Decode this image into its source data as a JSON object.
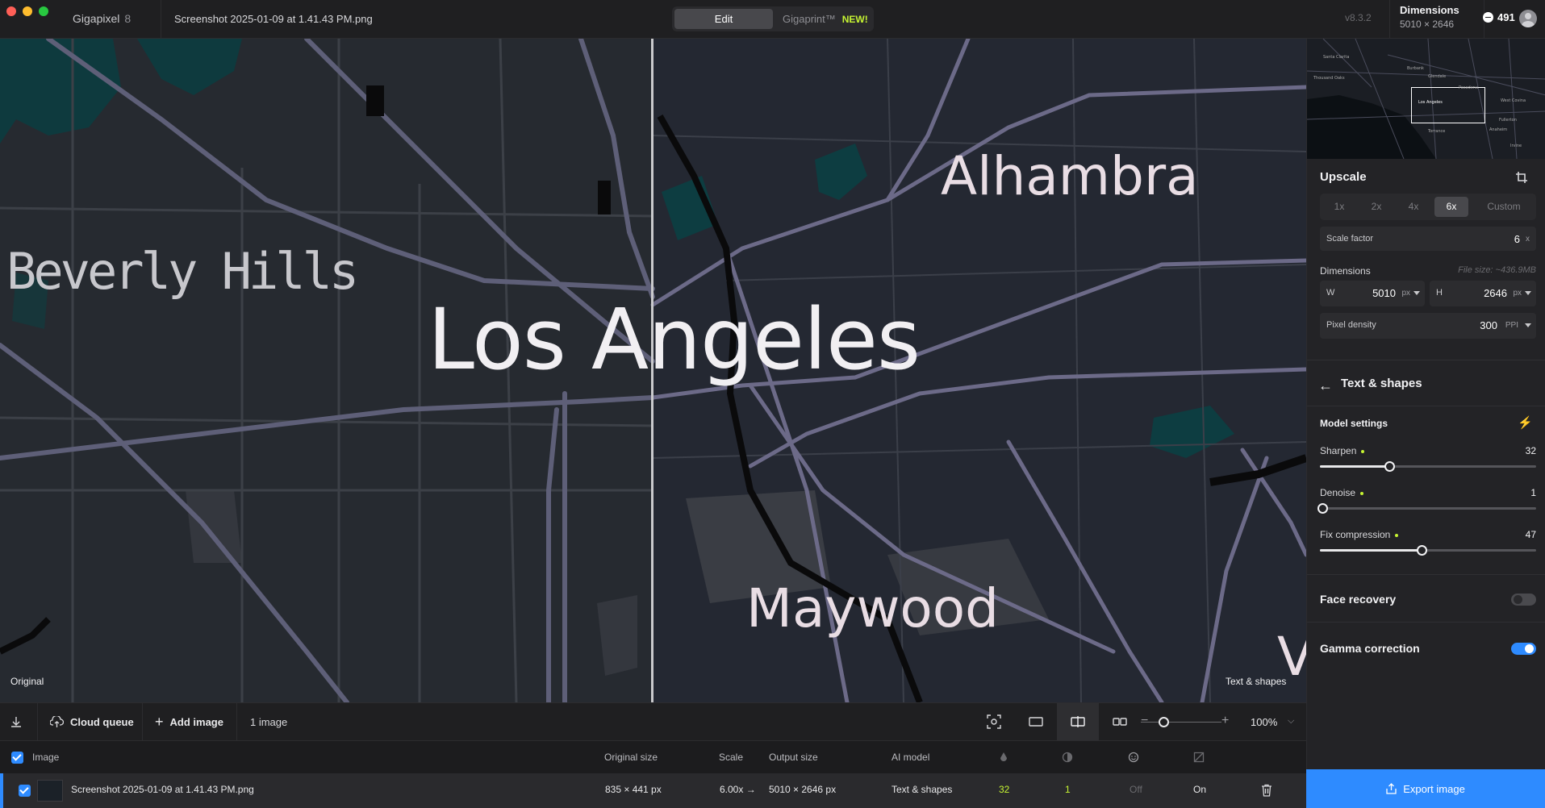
{
  "titlebar": {
    "app_name": "Gigapixel",
    "app_version": "8",
    "file_name": "Screenshot 2025-01-09 at 1.41.43 PM.png",
    "mode_edit": "Edit",
    "mode_gigaprint": "Gigaprint™",
    "new_badge": "NEW!",
    "version": "v8.3.2",
    "dimensions_title": "Dimensions",
    "dimensions_value": "5010 × 2646",
    "credits": "491"
  },
  "canvas": {
    "labels": {
      "los_angeles": "Los Angeles",
      "beverly_hills": "Beverly Hills",
      "alhambra": "Alhambra",
      "maywood": "Maywood",
      "partial": "V"
    },
    "left_caption": "Original",
    "right_caption": "Text & shapes",
    "minimap_labels": [
      "Los Angeles",
      "Santa Clarita",
      "Thousand Oaks",
      "Pasadena",
      "West Covina",
      "Torrance",
      "Fullerton",
      "Anaheim",
      "Irvine",
      "Glendale",
      "Burbank"
    ]
  },
  "panel": {
    "upscale_title": "Upscale",
    "scale_options": [
      "1x",
      "2x",
      "4x",
      "6x",
      "Custom"
    ],
    "scale_active": "6x",
    "scale_factor_label": "Scale factor",
    "scale_factor_value": "6",
    "scale_factor_unit": "x",
    "dimensions_label": "Dimensions",
    "file_size": "File size: ~436.9MB",
    "width_label": "W",
    "width_value": "5010",
    "width_unit": "px",
    "height_label": "H",
    "height_value": "2646",
    "height_unit": "px",
    "density_label": "Pixel density",
    "density_value": "300",
    "density_unit": "PPI",
    "model_name": "Text & shapes",
    "model_settings_title": "Model settings",
    "sliders": [
      {
        "label": "Sharpen",
        "value": "32",
        "fraction": 0.32
      },
      {
        "label": "Denoise",
        "value": "1",
        "fraction": 0.01
      },
      {
        "label": "Fix compression",
        "value": "47",
        "fraction": 0.47
      }
    ],
    "face_recovery_label": "Face recovery",
    "face_recovery_on": false,
    "gamma_label": "Gamma correction",
    "gamma_on": true
  },
  "toolbar": {
    "cloud_queue": "Cloud queue",
    "add_image": "Add image",
    "image_count": "1 image",
    "zoom": "100%"
  },
  "table": {
    "headers": {
      "image": "Image",
      "original_size": "Original size",
      "scale": "Scale",
      "output_size": "Output size",
      "ai_model": "AI model"
    },
    "row": {
      "name": "Screenshot 2025-01-09 at 1.41.43 PM.png",
      "original_size": "835 × 441 px",
      "scale": "6.00x",
      "arrow": "→",
      "output_size": "5010 × 2646 px",
      "ai_model": "Text & shapes",
      "sharpen": "32",
      "denoise": "1",
      "face": "Off",
      "gamma": "On"
    }
  },
  "export": {
    "label": "Export image"
  },
  "colors": {
    "accent": "#2e8bff",
    "lime": "#c6f432",
    "panel_bg": "#232326"
  }
}
